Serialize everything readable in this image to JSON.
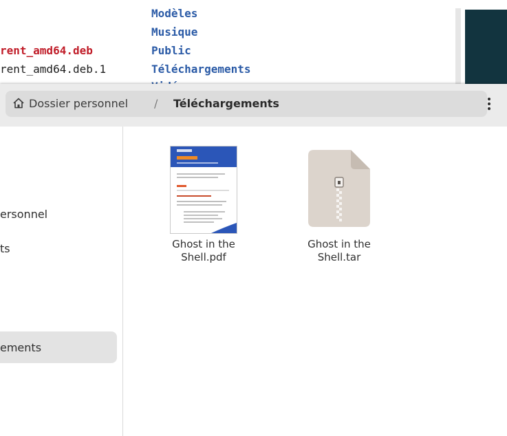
{
  "terminal": {
    "left_lines": [
      {
        "text": "rent_amd64.deb",
        "style": "red"
      },
      {
        "text": "rent_amd64.deb.1",
        "style": "plain"
      }
    ],
    "right_lines": [
      "Modèles",
      "Musique",
      "Public",
      "Téléchargements",
      "Vidéos"
    ]
  },
  "pathbar": {
    "home_label": "Dossier personnel",
    "separator": "/",
    "current_label": "Téléchargements"
  },
  "sidebar": {
    "items": [
      {
        "label": "ersonnel"
      },
      {
        "label": "ts"
      },
      {
        "label": "ements",
        "selected": true
      }
    ]
  },
  "files": [
    {
      "name_line1": "Ghost in the",
      "name_line2": "Shell.pdf",
      "type": "pdf"
    },
    {
      "name_line1": "Ghost in the",
      "name_line2": "Shell.tar",
      "type": "archive"
    }
  ],
  "colors": {
    "terminal_dir": "#2a5aa6",
    "terminal_archive": "#c01c28",
    "archive_icon": "#dcd4cc",
    "pdf_header": "#2b56b8"
  }
}
